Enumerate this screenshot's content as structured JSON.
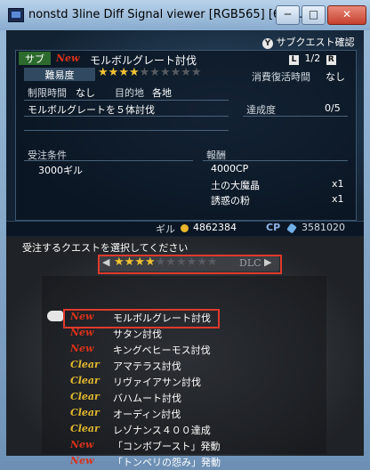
{
  "window": {
    "title": "nonstd 3line Diff Signal viewer  [RGB565] [60/...",
    "minimize": "─",
    "maximize": "□",
    "close": "✕"
  },
  "top": {
    "confirm_button": {
      "icon": "Y",
      "label": "サブクエスト確認"
    },
    "quest": {
      "category": "サブ",
      "badge": "New",
      "title": "モルボルグレート討伐",
      "page": "1/2",
      "left_key": "L",
      "right_key": "R",
      "difficulty_label": "難易度",
      "difficulty_stars": 4,
      "difficulty_max": 10,
      "revival_label": "消費復活時間",
      "revival_value": "なし",
      "time_limit_label": "制限時間",
      "time_limit_value": "なし",
      "destination_label": "目的地",
      "destination_value": "各地",
      "description": "モルボルグレートを５体討伐",
      "progress_label": "達成度",
      "progress_value": "0/5",
      "conditions_label": "受注条件",
      "conditions_value": "3000ギル",
      "reward_label": "報酬",
      "rewards": [
        {
          "name": "4000CP",
          "qty": ""
        },
        {
          "name": "土の大魔晶",
          "qty": "x1"
        },
        {
          "name": "誘惑の粉",
          "qty": "x1"
        }
      ]
    },
    "footer": {
      "gil_label": "ギル",
      "gil_value": "4862384",
      "cp_label": "CP",
      "cp_value": "3581020"
    }
  },
  "bottom": {
    "prompt": "受注するクエストを選択してください",
    "filter": {
      "stars_on": 4,
      "stars_total": 10,
      "tag": "DLC"
    },
    "quests": [
      {
        "status": "New",
        "name": "モルボルグレート討伐"
      },
      {
        "status": "New",
        "name": "サタン討伐"
      },
      {
        "status": "New",
        "name": "キングベヒーモス討伐"
      },
      {
        "status": "Clear",
        "name": "アマテラス討伐"
      },
      {
        "status": "Clear",
        "name": "リヴァイアサン討伐"
      },
      {
        "status": "Clear",
        "name": "バハムート討伐"
      },
      {
        "status": "Clear",
        "name": "オーディン討伐"
      },
      {
        "status": "Clear",
        "name": "レゾナンス４００達成"
      },
      {
        "status": "New",
        "name": "「コンボブースト」発動"
      },
      {
        "status": "New",
        "name": "「トンベリの怨み」発動"
      }
    ],
    "selected_index": 0
  },
  "colors": {
    "highlight_box": "#e03a2c",
    "new_badge": "#d6321c",
    "clear_badge": "#e3b92e",
    "star_on": "#f1c232",
    "star_off": "#565a62"
  }
}
